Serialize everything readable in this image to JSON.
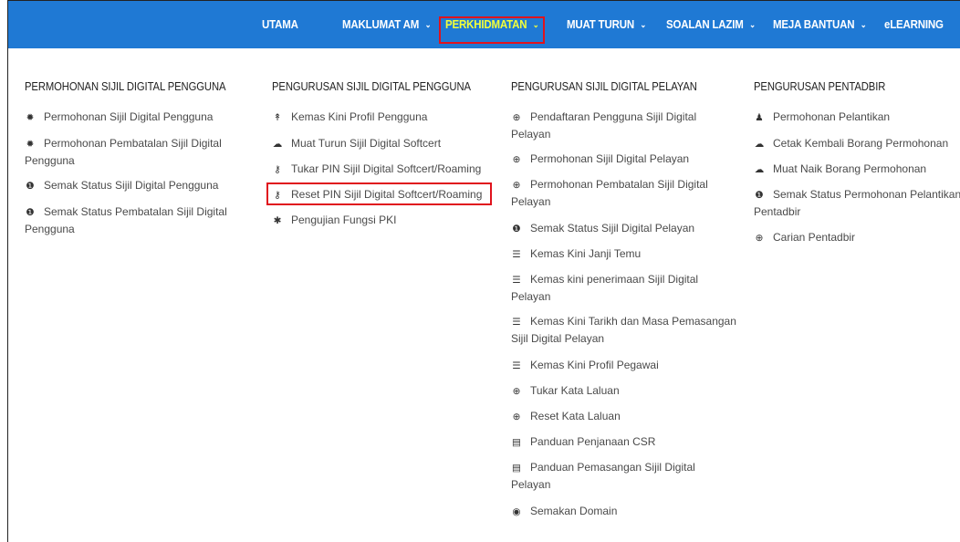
{
  "nav": {
    "items": [
      {
        "label": "UTAMA",
        "chevron": ""
      },
      {
        "label": "MAKLUMAT AM",
        "chevron": "⌄"
      },
      {
        "label": "PERKHIDMATAN",
        "chevron": "⌄"
      },
      {
        "label": "MUAT TURUN",
        "chevron": "⌄"
      },
      {
        "label": "SOALAN LAZIM",
        "chevron": "⌄"
      },
      {
        "label": "MEJA BANTUAN",
        "chevron": "⌄"
      },
      {
        "label": "eLEARNING",
        "chevron": ""
      }
    ],
    "active_color": "#f3ff3a",
    "bar_color": "#1f79d4"
  },
  "columns": [
    {
      "title": "PERMOHONAN SIJIL DIGITAL PENGGUNA",
      "items": [
        {
          "icon": "gear-icon",
          "glyph": "✹",
          "label": "Permohonan Sijil Digital Pengguna",
          "cont": ""
        },
        {
          "icon": "gear-icon",
          "glyph": "✹",
          "label": "Permohonan Pembatalan Sijil Digital",
          "cont": "Pengguna"
        },
        {
          "icon": "info-icon",
          "glyph": "❶",
          "label": "Semak Status Sijil Digital Pengguna",
          "cont": ""
        },
        {
          "icon": "info-icon",
          "glyph": "❶",
          "label": "Semak Status Pembatalan Sijil Digital",
          "cont": "Pengguna"
        }
      ]
    },
    {
      "title": "PENGURUSAN SIJIL DIGITAL PENGGUNA",
      "items": [
        {
          "icon": "user-tie-icon",
          "glyph": "↟",
          "label": "Kemas Kini Profil Pengguna"
        },
        {
          "icon": "cloud-download-icon",
          "glyph": "☁",
          "label": "Muat Turun Sijil Digital Softcert"
        },
        {
          "icon": "key-icon",
          "glyph": "⚷",
          "label": "Tukar PIN Sijil Digital Softcert/Roaming"
        },
        {
          "icon": "key-icon",
          "glyph": "⚷",
          "label": "Reset PIN Sijil Digital Softcert/Roaming"
        },
        {
          "icon": "asterisk-icon",
          "glyph": "✱",
          "label": "Pengujian Fungsi PKI"
        }
      ]
    },
    {
      "title": "PENGURUSAN SIJIL DIGITAL PELAYAN",
      "items": [
        {
          "icon": "server-icon",
          "glyph": "⊕",
          "label": "Pendaftaran Pengguna Sijil Digital",
          "cont": "Pelayan"
        },
        {
          "icon": "server-icon",
          "glyph": "⊕",
          "label": "Permohonan Sijil Digital Pelayan",
          "cont": ""
        },
        {
          "icon": "server-icon",
          "glyph": "⊕",
          "label": "Permohonan Pembatalan Sijil Digital",
          "cont": "Pelayan"
        },
        {
          "icon": "info-icon",
          "glyph": "❶",
          "label": "Semak Status Sijil Digital Pelayan",
          "cont": ""
        },
        {
          "icon": "list-icon",
          "glyph": "☰",
          "label": "Kemas Kini Janji Temu",
          "cont": ""
        },
        {
          "icon": "list-icon",
          "glyph": "☰",
          "label": "Kemas kini penerimaan Sijil Digital",
          "cont": "Pelayan"
        },
        {
          "icon": "list-icon",
          "glyph": "☰",
          "label": "Kemas Kini Tarikh dan Masa Pemasangan",
          "cont": "Sijil Digital Pelayan"
        },
        {
          "icon": "list-icon",
          "glyph": "☰",
          "label": "Kemas Kini Profil Pegawai",
          "cont": ""
        },
        {
          "icon": "lock-icon",
          "glyph": "⊕",
          "label": "Tukar Kata Laluan",
          "cont": ""
        },
        {
          "icon": "lock-icon",
          "glyph": "⊕",
          "label": "Reset Kata Laluan",
          "cont": ""
        },
        {
          "icon": "document-icon",
          "glyph": "▤",
          "label": "Panduan Penjanaan CSR",
          "cont": ""
        },
        {
          "icon": "document-icon",
          "glyph": "▤",
          "label": "Panduan Pemasangan Sijil Digital",
          "cont": "Pelayan"
        },
        {
          "icon": "globe-icon",
          "glyph": "◉",
          "label": "Semakan Domain",
          "cont": ""
        }
      ]
    },
    {
      "title": "PENGURUSAN PENTADBIR",
      "items": [
        {
          "icon": "user-icon",
          "glyph": "♟",
          "label": "Permohonan Pelantikan",
          "cont": ""
        },
        {
          "icon": "cloud-icon",
          "glyph": "☁",
          "label": "Cetak Kembali Borang Permohonan",
          "cont": ""
        },
        {
          "icon": "cloud-upload-icon",
          "glyph": "☁",
          "label": "Muat Naik Borang Permohonan",
          "cont": ""
        },
        {
          "icon": "info-icon",
          "glyph": "❶",
          "label": "Semak Status Permohonan Pelantikan",
          "cont": "Pentadbir"
        },
        {
          "icon": "search-icon",
          "glyph": "⊕",
          "label": "Carian Pentadbir",
          "cont": ""
        }
      ]
    }
  ]
}
